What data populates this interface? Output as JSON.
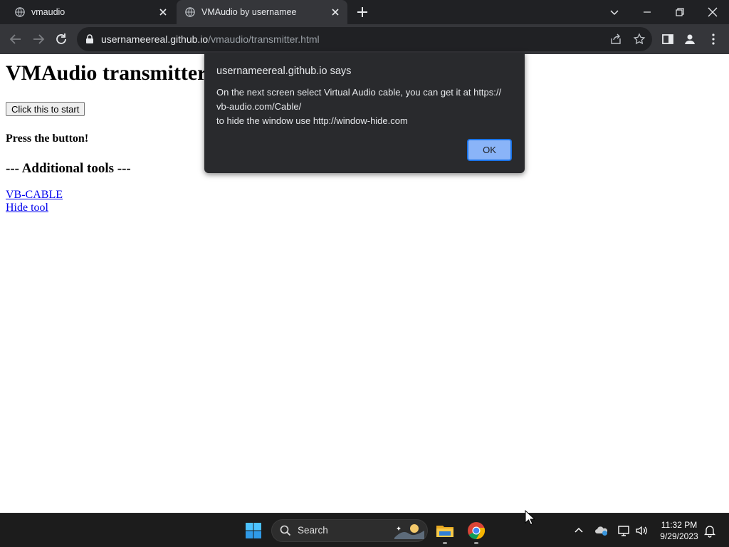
{
  "browser": {
    "tabs": [
      {
        "title": "vmaudio",
        "active": false
      },
      {
        "title": "VMAudio by usernamee",
        "active": true
      }
    ],
    "url_host": "usernameereal.github.io",
    "url_path": "/vmaudio/transmitter.html"
  },
  "page": {
    "heading": "VMAudio transmitter",
    "start_button": "Click this to start",
    "status": "Press the button!",
    "additional_tools": "--- Additional tools ---",
    "links": [
      "VB-CABLE",
      "Hide tool"
    ]
  },
  "dialog": {
    "title": "usernameereal.github.io says",
    "message_lines": [
      "On the next screen select Virtual Audio cable, you can get it at https://",
      "vb-audio.com/Cable/",
      "to hide the window use http://window-hide.com"
    ],
    "ok_label": "OK"
  },
  "taskbar": {
    "search_label": "Search",
    "time": "11:32 PM",
    "date": "9/29/2023",
    "icons": [
      "windows-start-icon",
      "file-explorer-icon",
      "chrome-icon",
      "show-hidden-icons",
      "onedrive-icon",
      "network-icon",
      "volume-icon",
      "notifications-icon"
    ]
  },
  "colors": {
    "tabstrip": "#202124",
    "toolbar": "#35363a",
    "dialog_bg": "#292a2d",
    "ok_button": "#8ab4f8",
    "link": "#0000ee",
    "taskbar": "#1c1c1c"
  }
}
